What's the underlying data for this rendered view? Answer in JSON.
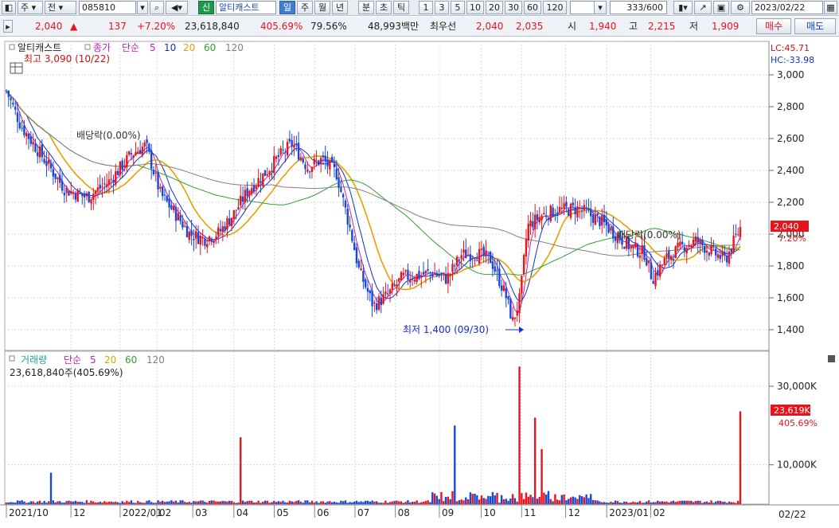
{
  "toolbar": {
    "period_sel": "주",
    "market_sel": "전",
    "code": "085810",
    "badge": "신",
    "name": "알티캐스트",
    "periods": [
      "일",
      "주",
      "월",
      "년",
      "분",
      "초",
      "틱"
    ],
    "active_period": "일",
    "intervals": [
      "1",
      "3",
      "5",
      "10",
      "20",
      "30",
      "60",
      "120"
    ],
    "count": "333",
    "count_total": "/600",
    "date": "2023/02/22"
  },
  "quote": {
    "price": "2,040",
    "arrow": "▲",
    "change": "137",
    "change_pct": "+7.20%",
    "volume": "23,618,840",
    "vol_ratio": "405.69%",
    "rate": "79.56%",
    "amount": "48,993백만",
    "best_label": "최우선",
    "ask": "2,040",
    "bid": "2,035",
    "open_label": "시",
    "open": "1,940",
    "high_label": "고",
    "high": "2,215",
    "low_label": "저",
    "low": "1,909",
    "buy_label": "매수",
    "sell_label": "매도"
  },
  "colors": {
    "up": "#e8141c",
    "down": "#1848d8",
    "ma5": "#c020c0",
    "ma10": "#1030d0",
    "ma20": "#e8a000",
    "ma60": "#30a030",
    "ma120": "#808080"
  },
  "price_panel": {
    "title": "알티캐스트",
    "legend_close": "종가",
    "legend_simple": "단순",
    "ma_periods": [
      "5",
      "10",
      "20",
      "60",
      "120"
    ],
    "max_label": "최고 3,090 (10/22)",
    "min_label": "최저 1,400 (09/30)",
    "dividend_label": "배당락(0.00%)",
    "lc": "LC:45.71",
    "hc": "HC:-33.98",
    "current_price": "2,040",
    "current_pct": "7.20%",
    "y_ticks": [
      "3,000",
      "2,800",
      "2,600",
      "2,400",
      "2,200",
      "2,000",
      "1,800",
      "1,600",
      "1,400"
    ]
  },
  "volume_panel": {
    "title": "거래량",
    "legend_simple": "단순",
    "ma_periods": [
      "5",
      "20",
      "60",
      "120"
    ],
    "info": "23,618,840주(405.69%)",
    "current": "23,619K",
    "current_pct": "405.69%",
    "y_ticks": [
      "30,000K",
      "10,000K"
    ]
  },
  "x_axis": {
    "labels": [
      "2021/10",
      "12",
      "2022/01",
      "02",
      "03",
      "04",
      "05",
      "06",
      "07",
      "08",
      "09",
      "10",
      "11",
      "12",
      "2023/01",
      "02"
    ],
    "current_date": "02/22"
  },
  "chart_data": {
    "type": "candlestick",
    "price_series": [
      {
        "t": 0.0,
        "v": 2900
      },
      {
        "t": 0.02,
        "v": 2680
      },
      {
        "t": 0.05,
        "v": 2480
      },
      {
        "t": 0.08,
        "v": 2280
      },
      {
        "t": 0.11,
        "v": 2230
      },
      {
        "t": 0.14,
        "v": 2330
      },
      {
        "t": 0.17,
        "v": 2500
      },
      {
        "t": 0.19,
        "v": 2560
      },
      {
        "t": 0.21,
        "v": 2250
      },
      {
        "t": 0.23,
        "v": 2130
      },
      {
        "t": 0.25,
        "v": 2000
      },
      {
        "t": 0.27,
        "v": 1970
      },
      {
        "t": 0.29,
        "v": 2010
      },
      {
        "t": 0.31,
        "v": 2130
      },
      {
        "t": 0.33,
        "v": 2280
      },
      {
        "t": 0.35,
        "v": 2370
      },
      {
        "t": 0.37,
        "v": 2480
      },
      {
        "t": 0.39,
        "v": 2570
      },
      {
        "t": 0.41,
        "v": 2420
      },
      {
        "t": 0.43,
        "v": 2470
      },
      {
        "t": 0.45,
        "v": 2380
      },
      {
        "t": 0.47,
        "v": 2000
      },
      {
        "t": 0.48,
        "v": 1780
      },
      {
        "t": 0.5,
        "v": 1550
      },
      {
        "t": 0.52,
        "v": 1620
      },
      {
        "t": 0.54,
        "v": 1730
      },
      {
        "t": 0.56,
        "v": 1740
      },
      {
        "t": 0.58,
        "v": 1760
      },
      {
        "t": 0.6,
        "v": 1720
      },
      {
        "t": 0.62,
        "v": 1870
      },
      {
        "t": 0.64,
        "v": 1880
      },
      {
        "t": 0.66,
        "v": 1840
      },
      {
        "t": 0.68,
        "v": 1620
      },
      {
        "t": 0.69,
        "v": 1450
      },
      {
        "t": 0.7,
        "v": 1600
      },
      {
        "t": 0.71,
        "v": 2050
      },
      {
        "t": 0.73,
        "v": 2120
      },
      {
        "t": 0.75,
        "v": 2150
      },
      {
        "t": 0.78,
        "v": 2160
      },
      {
        "t": 0.81,
        "v": 2080
      },
      {
        "t": 0.83,
        "v": 2000
      },
      {
        "t": 0.85,
        "v": 1920
      },
      {
        "t": 0.87,
        "v": 1880
      },
      {
        "t": 0.88,
        "v": 1720
      },
      {
        "t": 0.9,
        "v": 1850
      },
      {
        "t": 0.92,
        "v": 1920
      },
      {
        "t": 0.94,
        "v": 1960
      },
      {
        "t": 0.96,
        "v": 1890
      },
      {
        "t": 0.98,
        "v": 1840
      },
      {
        "t": 1.0,
        "v": 2040
      }
    ],
    "volume_spikes": [
      {
        "t": 0.06,
        "v": 8000
      },
      {
        "t": 0.32,
        "v": 17000
      },
      {
        "t": 0.61,
        "v": 20000
      },
      {
        "t": 0.7,
        "v": 35000
      },
      {
        "t": 0.72,
        "v": 22000
      },
      {
        "t": 0.73,
        "v": 14000
      },
      {
        "t": 1.0,
        "v": 23619
      }
    ]
  }
}
